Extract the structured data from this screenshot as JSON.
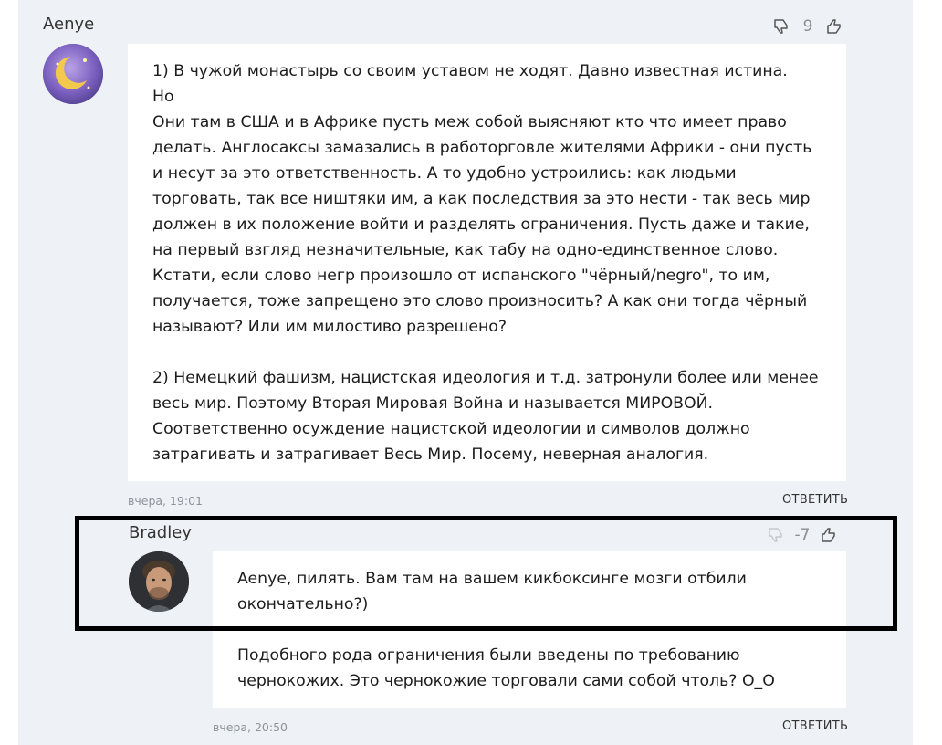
{
  "comment1": {
    "author": "Aenye",
    "rating": "9",
    "paragraphs": [
      "1) В чужой монастырь со своим уставом не ходят. Давно известная истина.",
      "Но",
      "Они там в США и в Африке пусть меж собой выясняют кто что имеет право делать. Англосаксы замазались в работорговле жителями Африки - они пусть и несут за это ответственность. А то удобно устроились: как людьми торговать, так все ништяки им, а как последствия за это нести - так весь мир должен в их положение войти и разделять ограничения. Пусть даже и такие, на первый взгляд незначительные, как табу на одно-единственное слово.",
      "Кстати, если слово негр произошло от испанского \"чёрный/negro\", то им, получается, тоже запрещено это слово произносить? А как они тогда чёрный называют? Или им милостиво разрешено?",
      "2) Немецкий фашизм, нацистская идеология и т.д. затронули более или менее весь мир. Поэтому Вторая Мировая Война и называется МИРОВОЙ. Соответственно осуждение нацистской идеологии и символов должно затрагивать и затрагивает Весь Мир. Посему, неверная аналогия."
    ],
    "time": "вчера, 19:01",
    "reply_label": "ОТВЕТИТЬ"
  },
  "comment2": {
    "author": "Bradley",
    "rating": "-7",
    "paragraphs": [
      "Aenye, пилять. Вам там на вашем кикбоксинге мозги отбили окончательно?)",
      "Подобного рода ограничения были введены по требованию чернокожих. Это чернокожие торговали сами собой чтоль? О_О"
    ],
    "time": "вчера, 20:50",
    "reply_label": "ОТВЕТИТЬ"
  },
  "colors": {
    "background": "#eef1f5",
    "bubble": "#ffffff",
    "muted": "#8a8f96",
    "highlight": "#000000"
  }
}
